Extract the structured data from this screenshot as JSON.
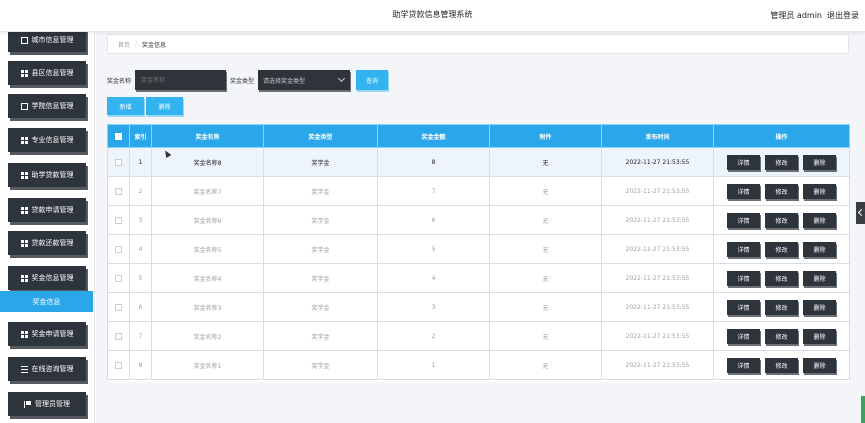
{
  "header": {
    "title": "助学贷款信息管理系统",
    "admin_label": "管理员 admin",
    "logout_label": "退出登录"
  },
  "sidebar": {
    "items": [
      {
        "label": "城市信息管理",
        "icon": "grid-icon"
      },
      {
        "label": "县区信息管理",
        "icon": "grid-icon"
      },
      {
        "label": "学院信息管理",
        "icon": "box-icon"
      },
      {
        "label": "专业信息管理",
        "icon": "grid-icon"
      },
      {
        "label": "助学贷款管理",
        "icon": "grid-icon"
      },
      {
        "label": "贷款申请管理",
        "icon": "grid-icon"
      },
      {
        "label": "贷款还款管理",
        "icon": "grid-icon"
      },
      {
        "label": "奖金信息管理",
        "icon": "grid-icon"
      },
      {
        "label": "奖金申请管理",
        "icon": "grid-icon"
      },
      {
        "label": "在线咨询管理",
        "icon": "lines-icon"
      },
      {
        "label": "管理员管理",
        "icon": "flag-icon"
      }
    ],
    "active_sub": "奖金信息"
  },
  "breadcrumb": {
    "home": "首页",
    "current": "奖金信息"
  },
  "search": {
    "name_label": "奖金名称",
    "name_placeholder": "奖金名称",
    "type_label": "奖金类型",
    "type_placeholder": "请选择奖金类型",
    "query_label": "查询"
  },
  "actions": {
    "add_label": "新增",
    "delete_label": "删除"
  },
  "table": {
    "columns": [
      "索引",
      "奖金名称",
      "奖金类型",
      "奖金金额",
      "附件",
      "发布时间",
      "操作"
    ],
    "op_labels": {
      "detail": "详情",
      "edit": "修改",
      "delete": "删除"
    },
    "rows": [
      {
        "idx": "1",
        "name": "奖金名称8",
        "type": "奖学金",
        "amount": "8",
        "attach": "无",
        "time": "2022-11-27 21:53:55"
      },
      {
        "idx": "2",
        "name": "奖金名称7",
        "type": "奖学金",
        "amount": "7",
        "attach": "无",
        "time": "2022-11-27 21:53:55"
      },
      {
        "idx": "3",
        "name": "奖金名称6",
        "type": "奖学金",
        "amount": "6",
        "attach": "无",
        "time": "2022-11-27 21:53:55"
      },
      {
        "idx": "4",
        "name": "奖金名称5",
        "type": "奖学金",
        "amount": "5",
        "attach": "无",
        "time": "2022-11-27 21:53:55"
      },
      {
        "idx": "5",
        "name": "奖金名称4",
        "type": "奖学金",
        "amount": "4",
        "attach": "无",
        "time": "2022-11-27 21:53:55"
      },
      {
        "idx": "6",
        "name": "奖金名称3",
        "type": "奖学金",
        "amount": "3",
        "attach": "无",
        "time": "2022-11-27 21:53:55"
      },
      {
        "idx": "7",
        "name": "奖金名称2",
        "type": "奖学金",
        "amount": "2",
        "attach": "无",
        "time": "2022-11-27 21:53:55"
      },
      {
        "idx": "8",
        "name": "奖金名称1",
        "type": "奖学金",
        "amount": "1",
        "attach": "无",
        "time": "2022-11-27 21:53:55"
      }
    ]
  }
}
